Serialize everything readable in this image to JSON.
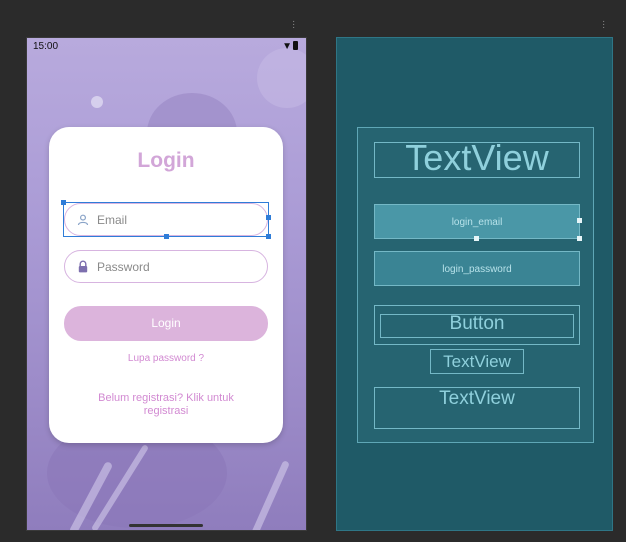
{
  "status_bar": {
    "time": "15:00"
  },
  "login_card": {
    "title": "Login",
    "email_placeholder": "Email",
    "password_placeholder": "Password",
    "login_button": "Login",
    "forgot_link": "Lupa password ?",
    "register_link": "Belum registrasi? Klik untuk registrasi"
  },
  "blueprint": {
    "title_view": "TextView",
    "email_view": "login_email",
    "password_view": "login_password",
    "button_view": "Button",
    "forgot_view": "TextView",
    "register_view": "TextView"
  },
  "colors": {
    "accent": "#d2a6d8",
    "button": "#dcb4dc",
    "link": "#d28ad2",
    "blueprint_bg": "#1f5a67",
    "selection": "#2f7dd8"
  },
  "icons": {
    "email": "person-icon",
    "password": "lock-icon"
  }
}
